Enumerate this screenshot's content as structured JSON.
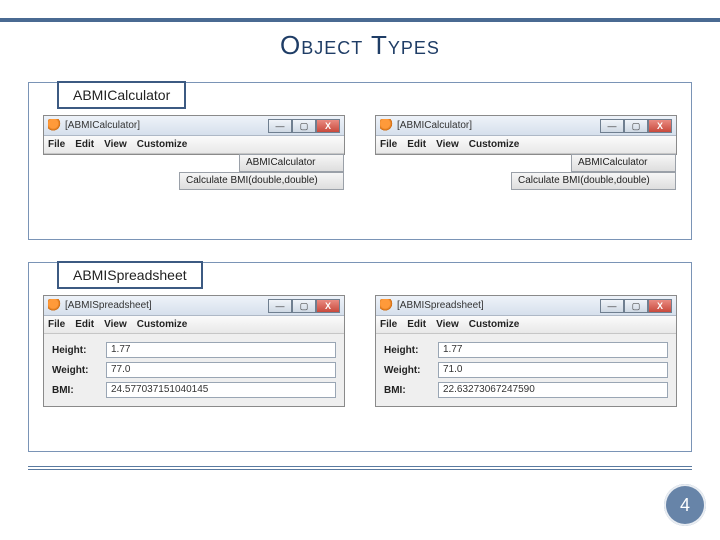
{
  "title": "Object Types",
  "page_number": "4",
  "sections": {
    "calc": {
      "label": "ABMICalculator",
      "win_title": "[ABMICalculator]",
      "menu": [
        "File",
        "Edit",
        "View",
        "Customize"
      ],
      "class_btn": "ABMICalculator",
      "method_btn": "Calculate BMI(double,double)"
    },
    "sheet": {
      "label": "ABMISpreadsheet",
      "win_title": "[ABMISpreadsheet]",
      "menu": [
        "File",
        "Edit",
        "View",
        "Customize"
      ],
      "rows": {
        "height": "Height:",
        "weight": "Weight:",
        "bmi": "BMI:"
      },
      "left": {
        "height": "1.77",
        "weight": "77.0",
        "bmi": "24.577037151040145"
      },
      "right": {
        "height": "1.77",
        "weight": "71.0",
        "bmi": "22.63273067247590"
      }
    }
  },
  "win_controls": {
    "min": "—",
    "max": "▢",
    "close": "X"
  }
}
